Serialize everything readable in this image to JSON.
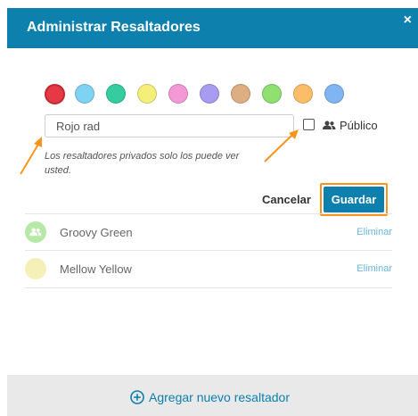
{
  "dialog": {
    "title": "Administrar Resaltadores",
    "close_glyph": "×"
  },
  "swatches": [
    {
      "name": "red",
      "color": "#e63946",
      "selected": true
    },
    {
      "name": "light-blue",
      "color": "#7fd3f2"
    },
    {
      "name": "teal",
      "color": "#35cc9f"
    },
    {
      "name": "yellow",
      "color": "#f5ee7a"
    },
    {
      "name": "pink",
      "color": "#f39ad6"
    },
    {
      "name": "lavender",
      "color": "#a79cf0"
    },
    {
      "name": "tan",
      "color": "#dcae82"
    },
    {
      "name": "green",
      "color": "#8fe070"
    },
    {
      "name": "orange",
      "color": "#fbbd68"
    },
    {
      "name": "blue",
      "color": "#7fb6f2"
    }
  ],
  "form": {
    "name_value": "Rojo rad",
    "public_label": "Público",
    "public_checked": false,
    "hint": "Los resaltadores privados solo los puede ver usted."
  },
  "actions": {
    "cancel_label": "Cancelar",
    "save_label": "Guardar"
  },
  "highlighters": [
    {
      "name": "Groovy Green",
      "color": "#b8e8a8",
      "icon": "users-icon",
      "delete_label": "Eliminar"
    },
    {
      "name": "Mellow Yellow",
      "color": "#f5f0b8",
      "icon": "",
      "delete_label": "Eliminar"
    }
  ],
  "footer": {
    "add_label": "Agregar nuevo resaltador"
  },
  "colors": {
    "brand": "#0d80ad",
    "annotation_arrow": "#f7941d"
  }
}
